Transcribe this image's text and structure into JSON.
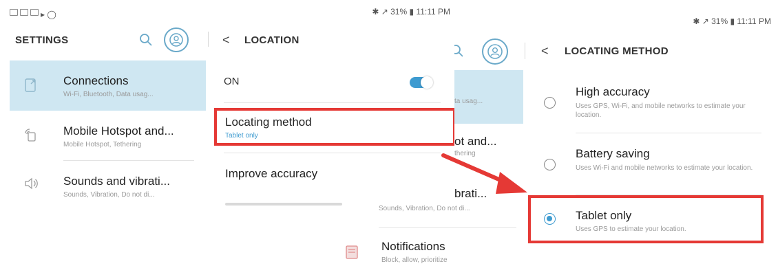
{
  "left_screen": {
    "status_right": "✱ ↗ 31% ▮ 11:11 PM",
    "settings_panel": {
      "title": "SETTINGS",
      "items": [
        {
          "title": "Connections",
          "subtitle": "Wi-Fi, Bluetooth, Data usag..."
        },
        {
          "title": "Mobile Hotspot and...",
          "subtitle": "Mobile Hotspot, Tethering"
        },
        {
          "title": "Sounds and vibrati...",
          "subtitle": "Sounds, Vibration, Do not di..."
        }
      ]
    },
    "location_panel": {
      "back_glyph": "<",
      "title": "LOCATION",
      "on_label": "ON",
      "toggle_on": true,
      "locating_method_title": "Locating method",
      "locating_method_value": "Tablet only",
      "improve_accuracy": "Improve accuracy"
    }
  },
  "right_screen": {
    "status_right": "✱ ↗ 31% ▮ 11:11 PM",
    "settings_partial": {
      "subtitle_fragment": "ta usag...",
      "item2_fragment": "ot and...",
      "item2_sub_fragment": "thering",
      "item3_fragment": "brati...",
      "item3_sub_fragment": "Sounds, Vibration, Do not di...",
      "notifications_title": "Notifications",
      "notifications_sub": "Block, allow, prioritize"
    },
    "locating_panel": {
      "back_glyph": "<",
      "title": "LOCATING METHOD",
      "options": [
        {
          "title": "High accuracy",
          "desc": "Uses GPS, Wi-Fi, and mobile networks to estimate your location.",
          "selected": false
        },
        {
          "title": "Battery saving",
          "desc": "Uses Wi-Fi and mobile networks to estimate your location.",
          "selected": false
        },
        {
          "title": "Tablet only",
          "desc": "Uses GPS to estimate your location.",
          "selected": true
        }
      ]
    }
  },
  "colors": {
    "accent": "#3e9bd0",
    "highlight": "#cfe7f2",
    "annotation_red": "#e53935"
  }
}
